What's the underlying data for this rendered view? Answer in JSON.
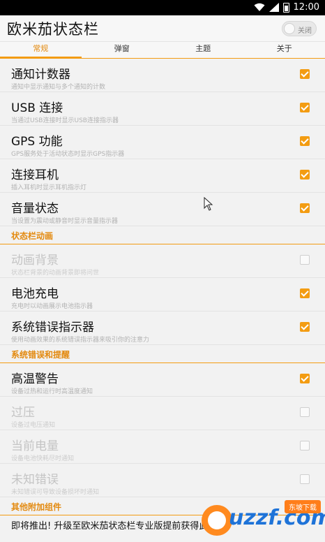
{
  "status_bar": {
    "time": "12:00",
    "icons": [
      "wifi-icon",
      "signal-icon",
      "battery-icon"
    ]
  },
  "app": {
    "title": "欧米茄状态栏",
    "toggle_label": "关闭"
  },
  "tabs": [
    {
      "label": "常规",
      "active": true
    },
    {
      "label": "弹窗",
      "active": false
    },
    {
      "label": "主题",
      "active": false
    },
    {
      "label": "关于",
      "active": false
    }
  ],
  "items_general": [
    {
      "title": "通知计数器",
      "subtitle": "通知中显示通知与多个通知的计数",
      "checked": true,
      "enabled": true
    },
    {
      "title": "USB 连接",
      "subtitle": "当通过USB连接时显示USB连接指示器",
      "checked": true,
      "enabled": true
    },
    {
      "title": "GPS 功能",
      "subtitle": "GPS服务处于活动状态时显示GPS指示器",
      "checked": true,
      "enabled": true
    },
    {
      "title": "连接耳机",
      "subtitle": "插入耳机时显示耳机指示灯",
      "checked": true,
      "enabled": true
    },
    {
      "title": "音量状态",
      "subtitle": "当设置为震动或静音时显示音量指示器",
      "checked": true,
      "enabled": true
    }
  ],
  "section_anim": {
    "header": "状态栏动画"
  },
  "items_anim": [
    {
      "title": "动画背景",
      "subtitle": "状态栏背景的动画背景即将问世",
      "checked": false,
      "enabled": false
    },
    {
      "title": "电池充电",
      "subtitle": "充电时以动画展示电池指示器",
      "checked": true,
      "enabled": true
    },
    {
      "title": "系统错误指示器",
      "subtitle": "使用动画效果的系统错误指示器来吸引你的注意力",
      "checked": true,
      "enabled": true
    }
  ],
  "section_alerts": {
    "header": "系统错误和提醒"
  },
  "items_alerts": [
    {
      "title": "高温警告",
      "subtitle": "设备过热和运行时高温度通知",
      "checked": true,
      "enabled": true
    },
    {
      "title": "过压",
      "subtitle": "设备过电压通知",
      "checked": false,
      "enabled": false
    },
    {
      "title": "当前电量",
      "subtitle": "设备电池快耗尽时通知",
      "checked": false,
      "enabled": false
    },
    {
      "title": "未知错误",
      "subtitle": "未知错误可导致设备损坏时通知",
      "checked": false,
      "enabled": false
    }
  ],
  "section_addons": {
    "header": "其他附加组件"
  },
  "promo": {
    "text": "即将推出! 升级至欧米茄状态栏专业版提前获得此功能!"
  },
  "watermark": {
    "logo": "uzzf.com",
    "badge": "东坡下载"
  }
}
